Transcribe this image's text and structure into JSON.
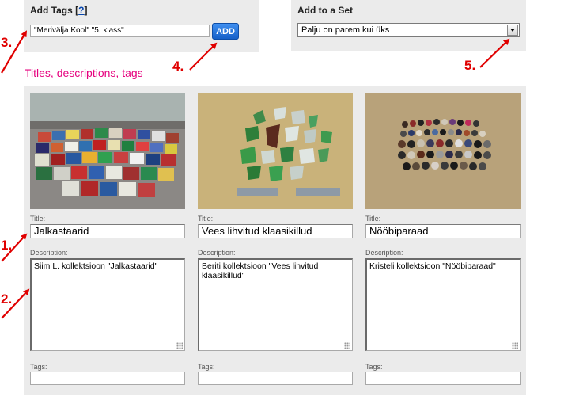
{
  "add_tags": {
    "title": "Add Tags",
    "help": "?",
    "input_value": "\"Merivälja Kool\" \"5. klass\"",
    "button_label": "ADD"
  },
  "add_to_set": {
    "title": "Add to a Set",
    "selected": "Palju on parem kui üks"
  },
  "section_heading": "Titles, descriptions, tags",
  "labels": {
    "title": "Title:",
    "description": "Description:",
    "tags": "Tags:"
  },
  "photos": [
    {
      "title": "Jalkastaarid",
      "description": "Siim L. kollektsioon \"Jalkastaarid\"",
      "tags": ""
    },
    {
      "title": "Vees lihvitud klaasikillud",
      "description": "Beriti kollektsioon \"Vees lihvitud klaasikillud\"",
      "tags": ""
    },
    {
      "title": "Nööbiparaad",
      "description": "Kristeli kollektsioon \"Nööbiparaad\"",
      "tags": ""
    }
  ],
  "markers": [
    "1.",
    "2.",
    "3.",
    "4.",
    "5."
  ],
  "colors": {
    "marker": "#e00000",
    "heading": "#e6007e",
    "button": "#1f6fd6",
    "panel": "#ebebeb"
  }
}
